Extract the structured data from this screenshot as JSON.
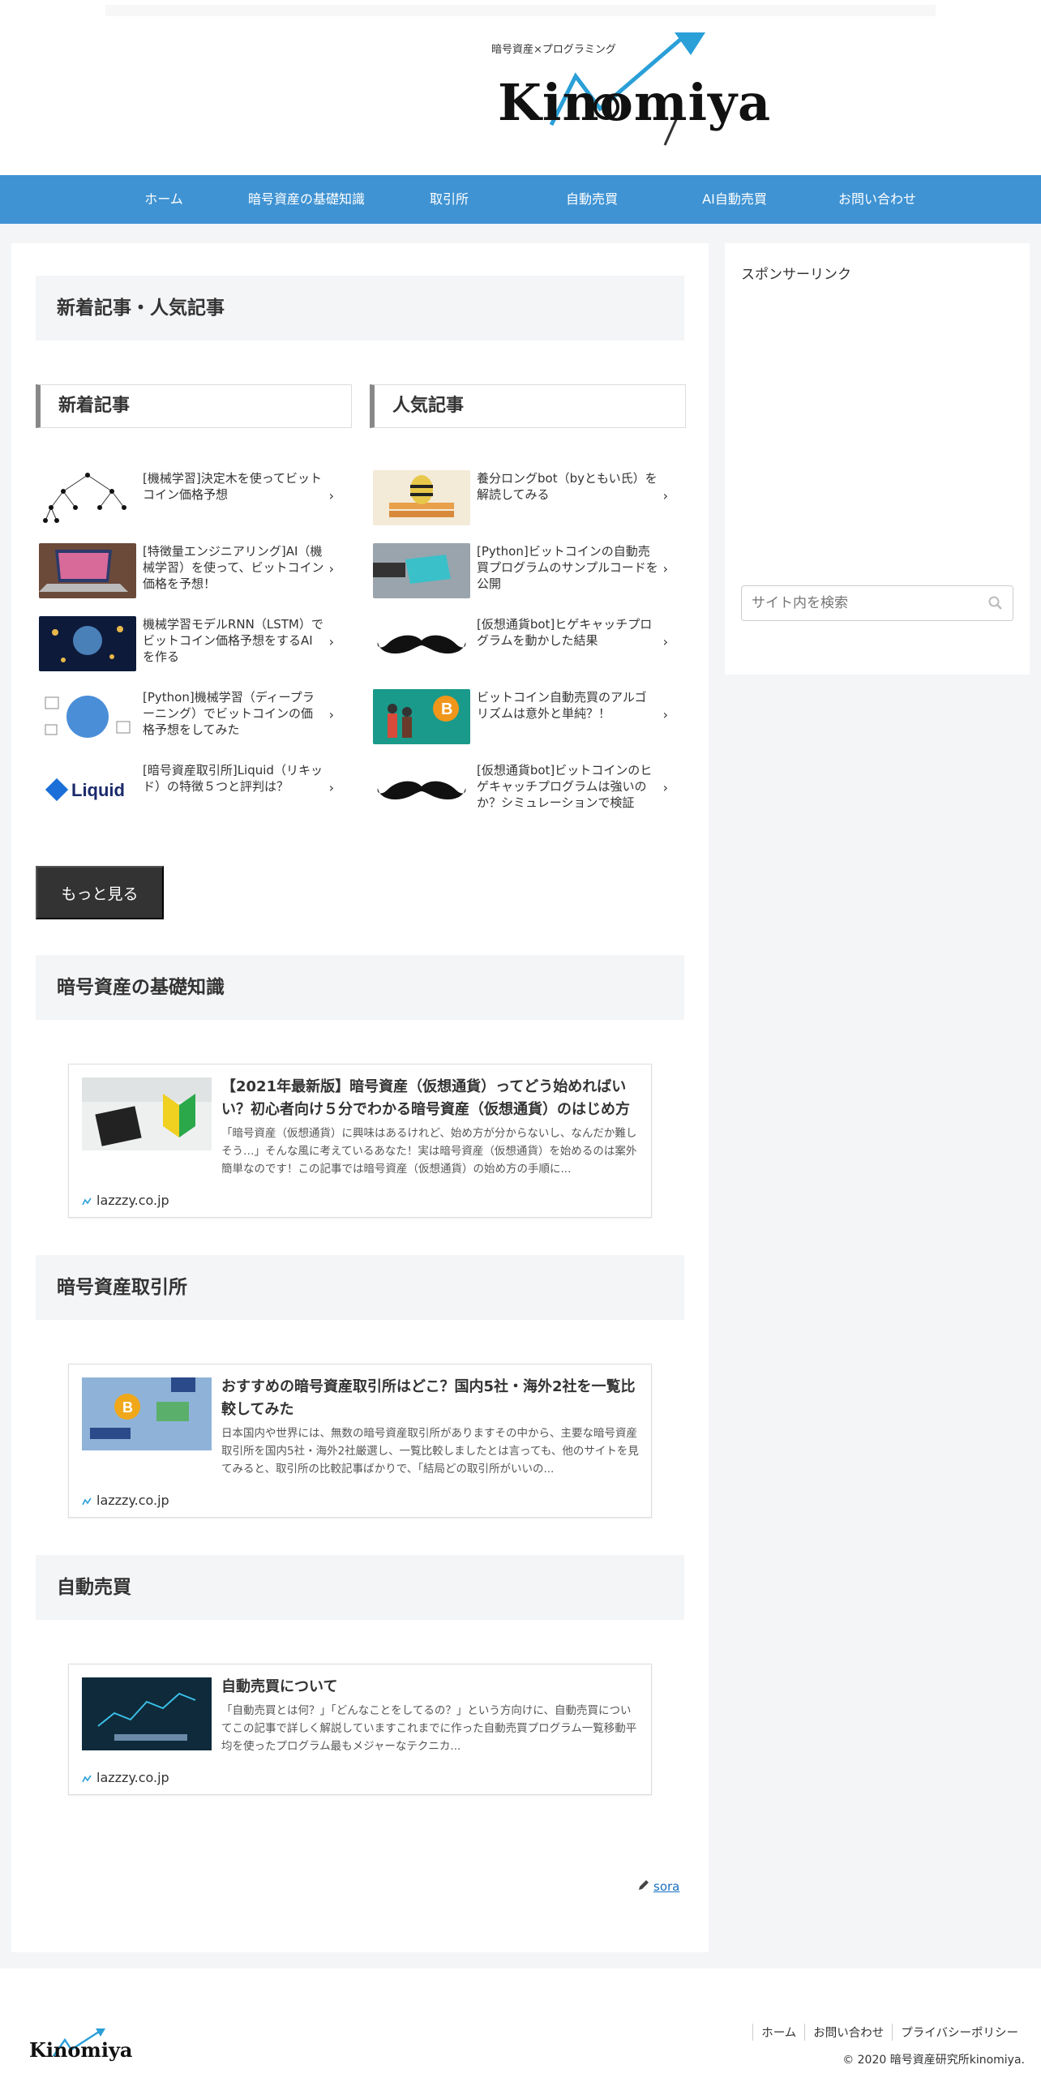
{
  "header": {
    "logo_text": "Kinomiya",
    "logo_subtitle": "暗号資産×プログラミング"
  },
  "nav": {
    "items": [
      "ホーム",
      "暗号資産の基礎知識",
      "取引所",
      "自動売買",
      "AI自動売買",
      "お問い合わせ"
    ]
  },
  "sidebar": {
    "sponsor_label": "スポンサーリンク",
    "search_placeholder": "サイト内を検索"
  },
  "main": {
    "section_title": "新着記事・人気記事",
    "new_tab": "新着記事",
    "popular_tab": "人気記事",
    "new_items": [
      "[機械学習]決定木を使ってビットコイン価格予想",
      "[特徴量エンジニアリング]AI（機械学習）を使って、ビットコイン価格を予想！",
      "機械学習モデルRNN（LSTM）でビットコイン価格予想をするAIを作る",
      "[Python]機械学習（ディープラーニング）でビットコインの価格予想をしてみた",
      "[暗号資産取引所]Liquid（リキッド）の特徴５つと評判は？"
    ],
    "popular_items": [
      "養分ロングbot（byともい氏）を解読してみる",
      "[Python]ビットコインの自動売買プログラムのサンプルコードを公開",
      "[仮想通貨bot]ヒゲキャッチプログラムを動かした結果",
      "ビットコイン自動売買のアルゴリズムは意外と単純？！",
      "[仮想通貨bot]ビットコインのヒゲキャッチプログラムは強いのか？シミュレーションで検証"
    ],
    "more_button": "もっと見る",
    "sections": [
      {
        "title": "暗号資産の基礎知識",
        "card_title": "【2021年最新版】暗号資産（仮想通貨）ってどう始めればいい？初心者向け５分でわかる暗号資産（仮想通貨）のはじめ方",
        "card_excerpt": "「暗号資産（仮想通貨）に興味はあるけれど、始め方が分からないし、なんだか難しそう…」そんな風に考えているあなた！実は暗号資産（仮想通貨）を始めるのは案外簡単なのです！この記事では暗号資産（仮想通貨）の始め方の手順に...",
        "card_site": "lazzzy.co.jp"
      },
      {
        "title": "暗号資産取引所",
        "card_title": "おすすめの暗号資産取引所はどこ？国内5社・海外2社を一覧比較してみた",
        "card_excerpt": "日本国内や世界には、無数の暗号資産取引所がありますその中から、主要な暗号資産取引所を国内5社・海外2社厳選し、一覧比較しましたとは言っても、他のサイトを見てみると、取引所の比較記事ばかりで、「結局どの取引所がいいの...",
        "card_site": "lazzzy.co.jp"
      },
      {
        "title": "自動売買",
        "card_title": "自動売買について",
        "card_excerpt": "「自動売買とは何？」「どんなことをしてるの？」という方向けに、自動売買についてこの記事で詳しく解説していますこれまでに作った自動売買プログラム一覧移動平均を使ったプログラム最もメジャーなテクニカ...",
        "card_site": "lazzzy.co.jp"
      }
    ],
    "author": "sora"
  },
  "footer": {
    "logo_text": "Kinomiya",
    "links": [
      "ホーム",
      "お問い合わせ",
      "プライバシーポリシー"
    ],
    "copyright": "© 2020 暗号資産研究所kinomiya."
  },
  "colors": {
    "nav_bg": "#3f93d3",
    "button_bg": "#333333",
    "link": "#1a6fc0",
    "logo_arrow": "#2a9fd8"
  }
}
